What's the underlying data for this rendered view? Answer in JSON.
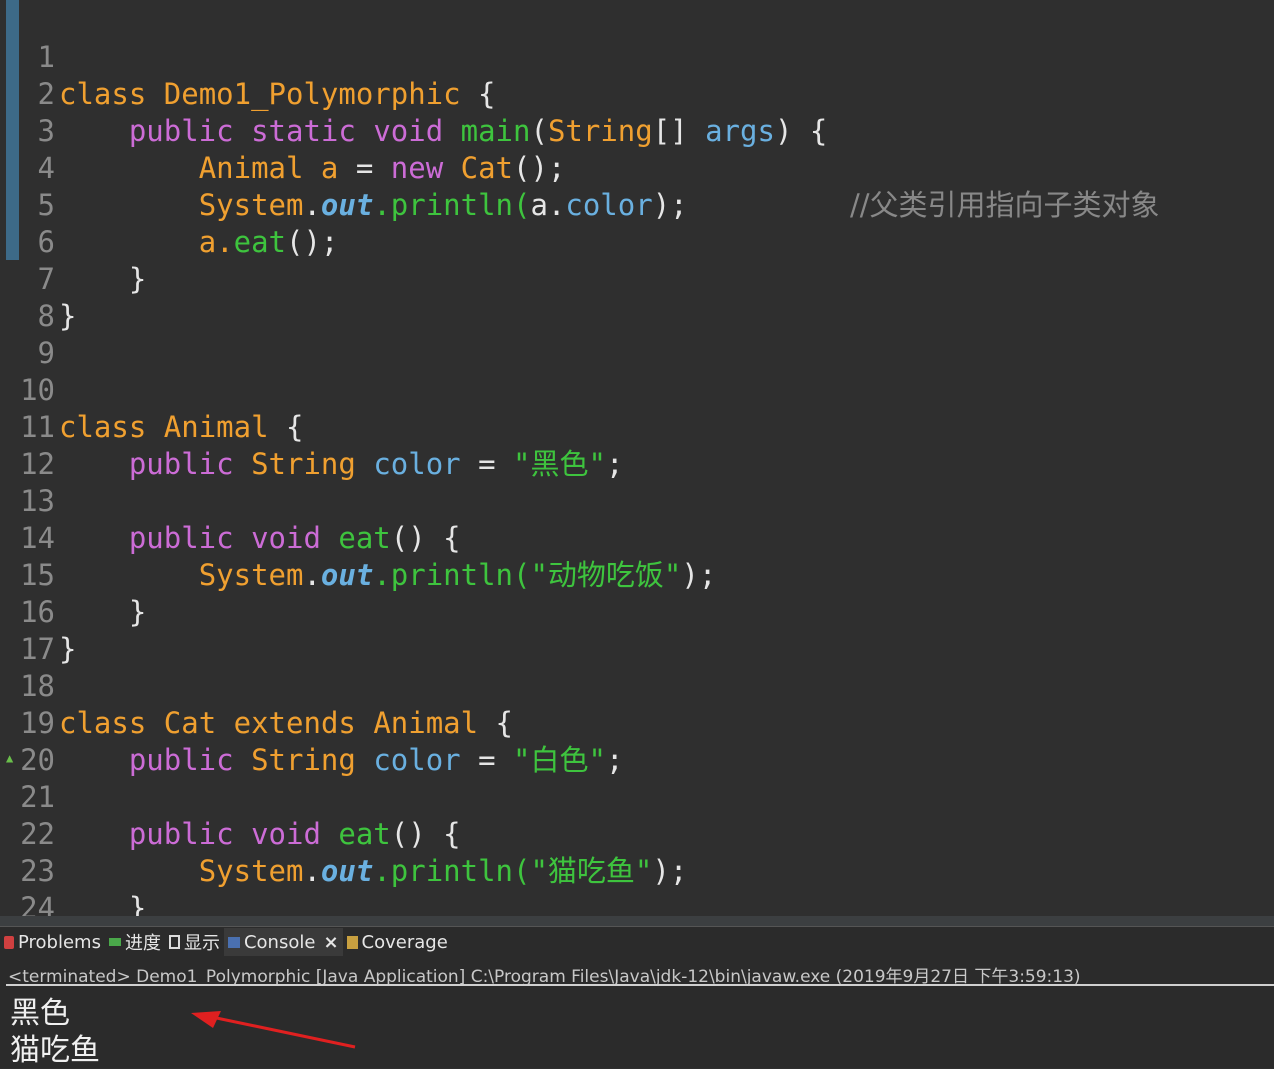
{
  "editor": {
    "lines": [
      {
        "n": "1"
      },
      {
        "n": "2"
      },
      {
        "n": "3"
      },
      {
        "n": "4"
      },
      {
        "n": "5"
      },
      {
        "n": "6"
      },
      {
        "n": "7"
      },
      {
        "n": "8"
      },
      {
        "n": "9"
      },
      {
        "n": "10"
      },
      {
        "n": "11"
      },
      {
        "n": "12"
      },
      {
        "n": "13"
      },
      {
        "n": "14"
      },
      {
        "n": "15"
      },
      {
        "n": "16"
      },
      {
        "n": "17"
      },
      {
        "n": "18"
      },
      {
        "n": "19"
      },
      {
        "n": "20"
      },
      {
        "n": "21"
      },
      {
        "n": "22"
      },
      {
        "n": "23"
      },
      {
        "n": "24"
      }
    ],
    "tokens": {
      "l1_class": "class",
      "l1_name": "Demo1_Polymorphic",
      "l1_brace": " {",
      "l2_public": "public",
      "l2_static": "static",
      "l2_void": "void",
      "l2_main": "main",
      "l2_paren": "(",
      "l2_string": "String",
      "l2_arr": "[] ",
      "l2_args": "args",
      "l2_end": ") {",
      "l3_animal": "Animal",
      "l3_a": "a",
      "l3_eq": " = ",
      "l3_new": "new",
      "l3_cat": "Cat",
      "l3_end": "();",
      "l3_comment": "//父类引用指向子类对象",
      "l4_system": "System",
      "l4_dot": ".",
      "l4_out": "out",
      "l4_println": ".println(",
      "l4_a": "a.",
      "l4_color": "color",
      "l4_end": ");",
      "l5_a": "a.",
      "l5_eat": "eat",
      "l5_end": "();",
      "l6": "}",
      "l7": "}",
      "l10_class": "class",
      "l10_animal": "Animal",
      "l10_brace": " {",
      "l11_public": "public",
      "l11_string": "String",
      "l11_color": "color",
      "l11_eq": " = ",
      "l11_str": "\"黑色\"",
      "l11_end": ";",
      "l13_public": "public",
      "l13_void": "void",
      "l13_eat": "eat",
      "l13_end": "() {",
      "l14_system": "System",
      "l14_dot": ".",
      "l14_out": "out",
      "l14_println": ".println(",
      "l14_str": "\"动物吃饭\"",
      "l14_end": ");",
      "l15": "}",
      "l16": "}",
      "l18_class": "class",
      "l18_cat": "Cat",
      "l18_extends": "extends",
      "l18_animal": "Animal",
      "l18_brace": " {",
      "l19_public": "public",
      "l19_string": "String",
      "l19_color": "color",
      "l19_eq": " = ",
      "l19_str": "\"白色\"",
      "l19_end": ";",
      "l21_public": "public",
      "l21_void": "void",
      "l21_eat": "eat",
      "l21_end": "() {",
      "l22_system": "System",
      "l22_dot": ".",
      "l22_out": "out",
      "l22_println": ".println(",
      "l22_str": "\"猫吃鱼\"",
      "l22_end": ");",
      "l23": "}",
      "l24": "}"
    }
  },
  "panel": {
    "tabs": [
      {
        "label": "Problems",
        "icon": "problems-icon"
      },
      {
        "label": "进度",
        "icon": "progress-icon"
      },
      {
        "label": "显示",
        "icon": "display-icon"
      },
      {
        "label": "Console",
        "icon": "console-icon",
        "close": "×"
      },
      {
        "label": "Coverage",
        "icon": "coverage-icon"
      }
    ],
    "status": "<terminated> Demo1_Polymorphic [Java Application] C:\\Program Files\\Java\\jdk-12\\bin\\javaw.exe (2019年9月27日 下午3:59:13)",
    "output": [
      "黑色",
      "猫吃鱼"
    ]
  },
  "colors": {
    "keyword": "#cc6cd6",
    "type": "#f0a030",
    "string": "#3ec43e",
    "field": "#6ab0e0",
    "arrow": "#e02020"
  }
}
